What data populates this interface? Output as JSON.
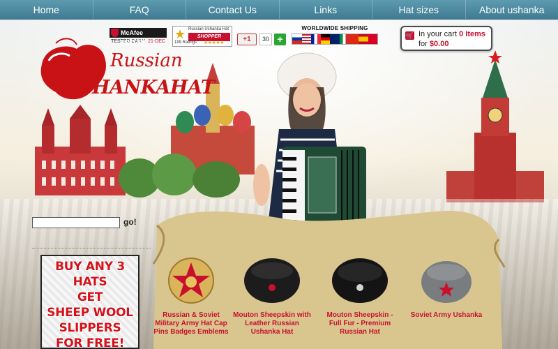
{
  "nav": {
    "items": [
      {
        "label": "Home"
      },
      {
        "label": "FAQ"
      },
      {
        "label": "Contact Us"
      },
      {
        "label": "Links"
      },
      {
        "label": "Hat sizes"
      },
      {
        "label": "About ushanka"
      }
    ]
  },
  "logo": {
    "line1": "Russian",
    "line2": "USHANKAHAT"
  },
  "badges": {
    "mcafee": {
      "title": "McAfee SECURE",
      "tested": "TESTED DAILY",
      "date": "21-DEC"
    },
    "shopper_approved": {
      "title": "Russian Ushanka Hat",
      "approved": "SHOPPER APPROVED",
      "ratings": "199 Ratings",
      "stars": "★★★★★"
    },
    "gplus": {
      "label": "+1",
      "count": "30"
    },
    "addthis": {
      "label": "+"
    },
    "shipping": {
      "label": "WORLDWIDE SHIPPING"
    }
  },
  "cart": {
    "prefix": "In your cart",
    "items": "0 Items",
    "for": "for",
    "total": "$0.00"
  },
  "search": {
    "value": "",
    "button": "go!"
  },
  "promo": {
    "lines": [
      "BUY ANY 3 HATS",
      "GET",
      "SHEEP WOOL",
      "SLIPPERS",
      "FOR FREE!"
    ]
  },
  "products": [
    {
      "name": "Russian & Soviet Military Army Hat Cap Pins Badges Emblems",
      "icon": "red-star-badge-icon"
    },
    {
      "name": "Mouton Sheepskin with Leather Russian Ushanka Hat",
      "icon": "black-ushanka-hat-icon"
    },
    {
      "name": "Mouton Sheepskin - Full Fur - Premium Russian Hat",
      "icon": "black-fur-ushanka-hat-icon"
    },
    {
      "name": "Soviet Army Ushanka",
      "icon": "gray-army-ushanka-icon"
    }
  ],
  "colors": {
    "nav_bg": "#4a88a0",
    "brand_red": "#c8102e",
    "accent_red": "#d4121b"
  }
}
